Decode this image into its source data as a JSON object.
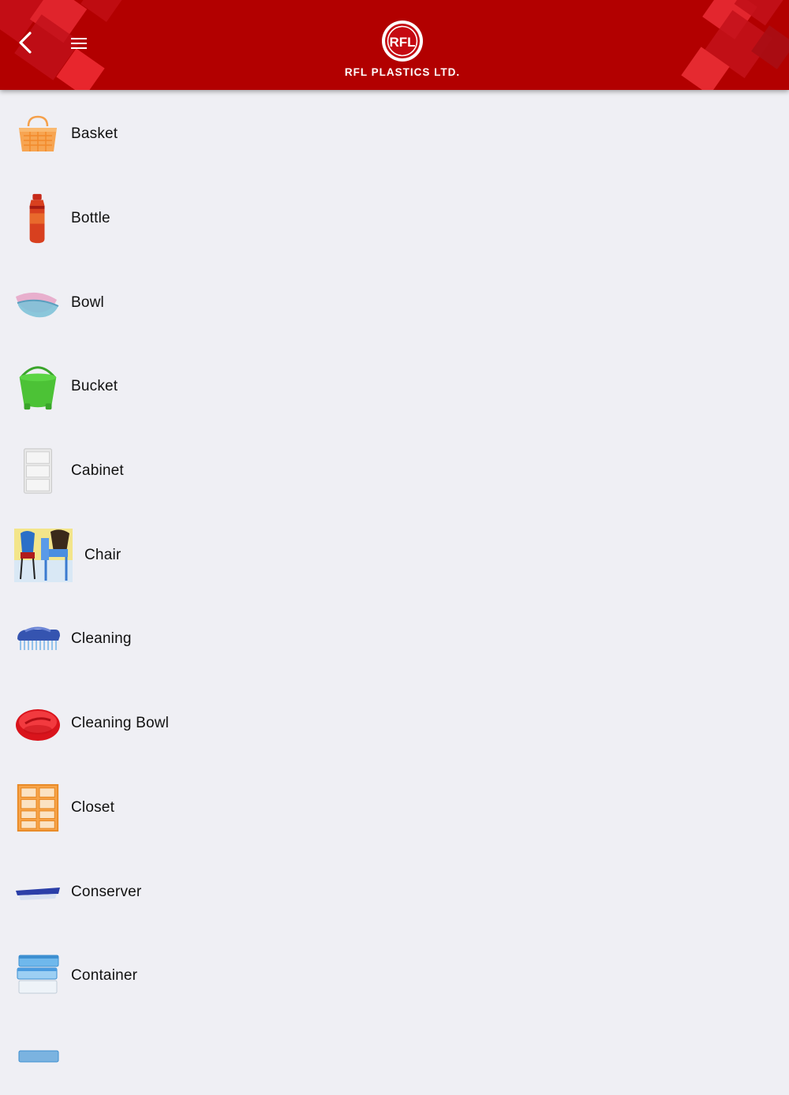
{
  "header": {
    "brand_text": "RFL PLASTICS LTD.",
    "logo_letters": "RFL",
    "background_color": "#b20000",
    "back_icon": "chevron-left-icon",
    "menu_icon": "hamburger-menu-icon"
  },
  "categories": [
    {
      "label": "Basket",
      "icon": "basket-icon"
    },
    {
      "label": "Bottle",
      "icon": "bottle-icon"
    },
    {
      "label": "Bowl",
      "icon": "bowl-icon"
    },
    {
      "label": "Bucket",
      "icon": "bucket-icon"
    },
    {
      "label": "Cabinet",
      "icon": "cabinet-icon"
    },
    {
      "label": "Chair",
      "icon": "chair-icon"
    },
    {
      "label": "Cleaning",
      "icon": "brush-icon"
    },
    {
      "label": "Cleaning Bowl",
      "icon": "cleaning-bowl-icon"
    },
    {
      "label": "Closet",
      "icon": "closet-icon"
    },
    {
      "label": "Conserver",
      "icon": "conserver-icon"
    },
    {
      "label": "Container",
      "icon": "container-icon"
    }
  ]
}
